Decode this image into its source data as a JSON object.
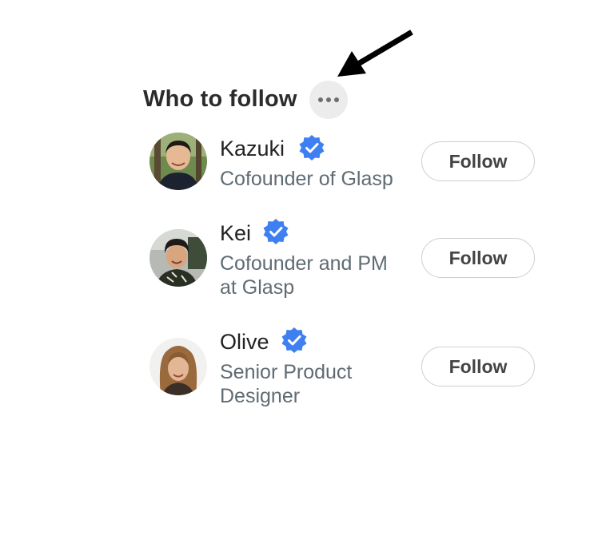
{
  "panel": {
    "title": "Who to follow",
    "more_icon": "more-horizontal-icon"
  },
  "users": [
    {
      "name": "Kazuki",
      "bio": "Cofounder of Glasp",
      "verified": true,
      "follow_label": "Follow"
    },
    {
      "name": "Kei",
      "bio": "Cofounder and PM at Glasp",
      "verified": true,
      "follow_label": "Follow"
    },
    {
      "name": "Olive",
      "bio": "Senior Product Designer",
      "verified": true,
      "follow_label": "Follow"
    }
  ],
  "colors": {
    "verified_badge": "#3e7ff2",
    "title_text": "#2b2b2b",
    "bio_text": "#5f6b73",
    "more_button_bg": "#ececec",
    "annotation_arrow": "#000000"
  }
}
